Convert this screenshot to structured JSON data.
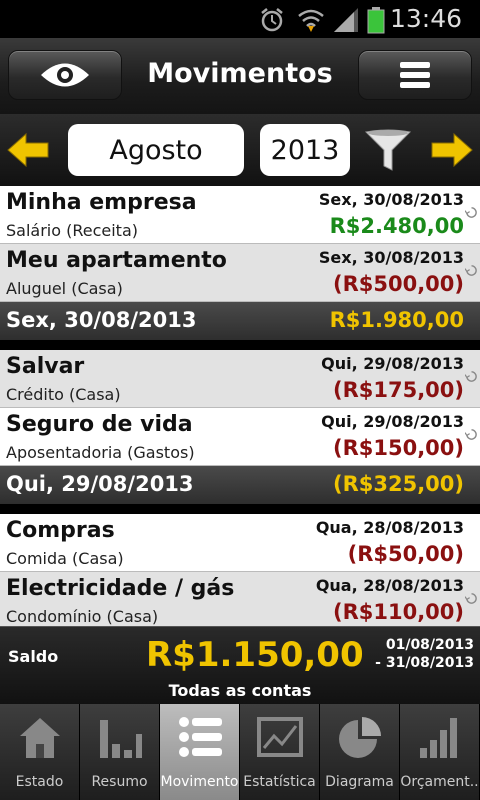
{
  "status_bar": {
    "time": "13:46"
  },
  "header": {
    "title": "Movimentos"
  },
  "period": {
    "month": "Agosto",
    "year": "2013"
  },
  "days": [
    {
      "transactions": [
        {
          "name": "Minha empresa",
          "category": "Salário (Receita)",
          "date": "Sex, 30/08/2013",
          "amount": "R$2.480,00",
          "type": "pos",
          "shade": "white"
        },
        {
          "name": "Meu apartamento",
          "category": "Aluguel (Casa)",
          "date": "Sex, 30/08/2013",
          "amount": "(R$500,00)",
          "type": "neg",
          "shade": "grey"
        }
      ],
      "total_label": "Sex, 30/08/2013",
      "total_value": "R$1.980,00"
    },
    {
      "transactions": [
        {
          "name": "Salvar",
          "category": "Crédito (Casa)",
          "date": "Qui, 29/08/2013",
          "amount": "(R$175,00)",
          "type": "neg",
          "shade": "grey"
        },
        {
          "name": "Seguro de vida",
          "category": "Aposentadoria (Gastos)",
          "date": "Qui, 29/08/2013",
          "amount": "(R$150,00)",
          "type": "neg",
          "shade": "white"
        }
      ],
      "total_label": "Qui, 29/08/2013",
      "total_value": "(R$325,00)"
    },
    {
      "transactions": [
        {
          "name": "Compras",
          "category": "Comida (Casa)",
          "date": "Qua, 28/08/2013",
          "amount": "(R$50,00)",
          "type": "neg",
          "shade": "white"
        },
        {
          "name": "Electricidade / gás",
          "category": "Condomínio (Casa)",
          "date": "Qua, 28/08/2013",
          "amount": "(R$110,00)",
          "type": "neg",
          "shade": "grey"
        }
      ]
    }
  ],
  "saldo": {
    "label": "Saldo",
    "value": "R$1.150,00",
    "range_start": "01/08/2013",
    "range_end": "- 31/08/2013",
    "account": "Todas as contas"
  },
  "tabs": [
    {
      "label": "Estado",
      "icon": "house-icon"
    },
    {
      "label": "Resumo",
      "icon": "bar-chart-icon"
    },
    {
      "label": "Movimento",
      "icon": "list-icon",
      "active": true
    },
    {
      "label": "Estatística",
      "icon": "line-chart-icon"
    },
    {
      "label": "Diagrama",
      "icon": "pie-chart-icon"
    },
    {
      "label": "Orçament..",
      "icon": "budget-bars-icon"
    }
  ],
  "colors": {
    "positive": "#1a8a1a",
    "negative": "#8a1010",
    "accent": "#f0c400"
  }
}
